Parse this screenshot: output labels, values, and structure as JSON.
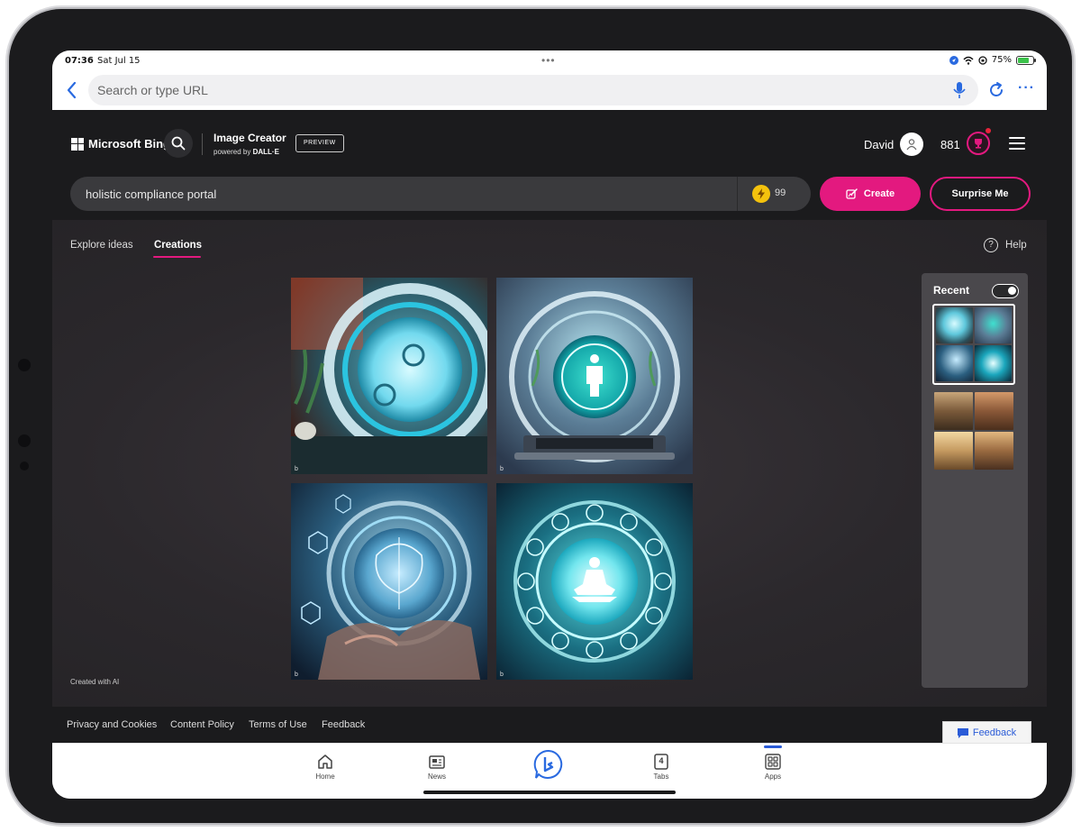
{
  "status_bar": {
    "time": "07:36",
    "date": "Sat Jul 15",
    "battery": "75%",
    "battery_fill": 0.75
  },
  "browser": {
    "url_placeholder": "Search or type URL"
  },
  "header": {
    "brand": "Microsoft Bing",
    "product_title": "Image Creator",
    "powered_by": "powered by",
    "powered_by_brand": "DALL·E",
    "preview_badge": "PREVIEW",
    "user_name": "David",
    "points": "881"
  },
  "prompt": {
    "value": "holistic compliance portal",
    "boosts": "99",
    "create_label": "Create",
    "surprise_label": "Surprise Me"
  },
  "tabs": [
    {
      "label": "Explore ideas"
    },
    {
      "label": "Creations"
    }
  ],
  "help_label": "Help",
  "images": [
    {
      "mark": "b"
    },
    {
      "mark": "b"
    },
    {
      "mark": "b"
    },
    {
      "mark": "b"
    }
  ],
  "created_with_ai": "Created with AI",
  "recent": {
    "title": "Recent"
  },
  "footer": {
    "links": [
      "Privacy and Cookies",
      "Content Policy",
      "Terms of Use",
      "Feedback"
    ],
    "feedback_button": "Feedback"
  },
  "app_bar": {
    "items": [
      {
        "label": "Home"
      },
      {
        "label": "News"
      },
      {
        "label": "Tabs",
        "badge": "4"
      },
      {
        "label": "Apps"
      }
    ]
  },
  "colors": {
    "accent": "#e3197f",
    "link_blue": "#2a6ae0"
  }
}
